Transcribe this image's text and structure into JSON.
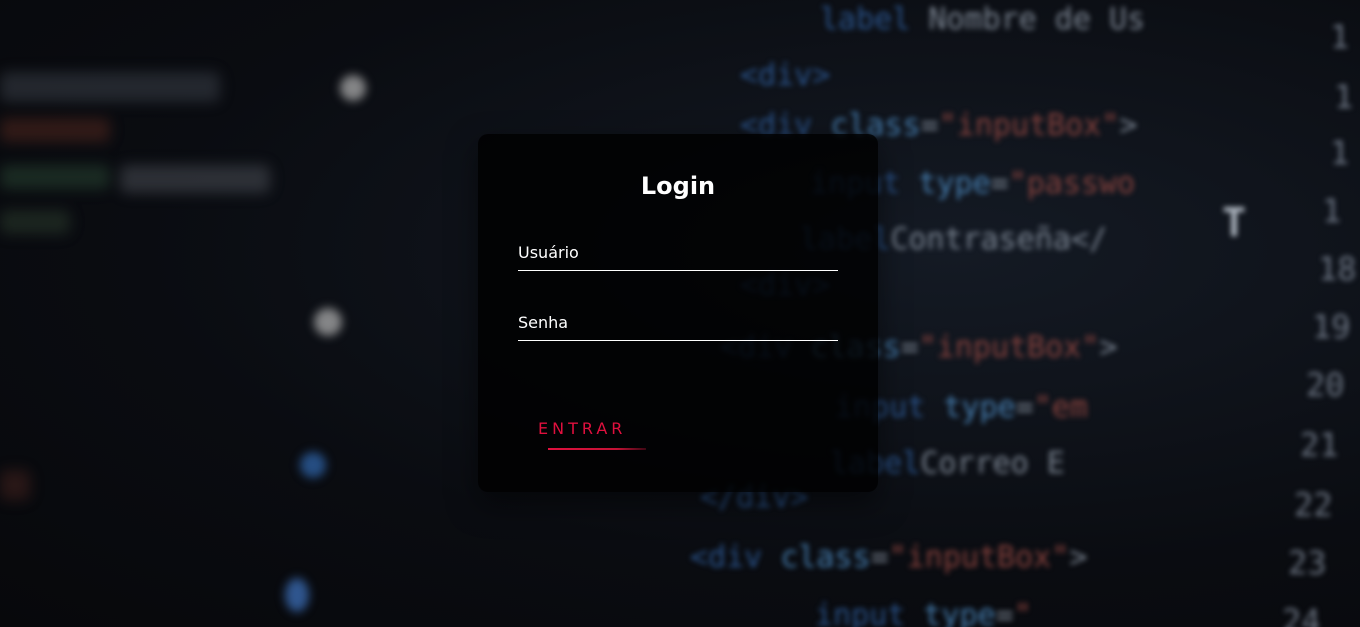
{
  "login": {
    "title": "Login",
    "username_label": "Usuário",
    "password_label": "Senha",
    "submit_label": "ENTRAR"
  },
  "colors": {
    "accent": "#e0103e",
    "panel": "#000000",
    "text": "#ffffff"
  }
}
